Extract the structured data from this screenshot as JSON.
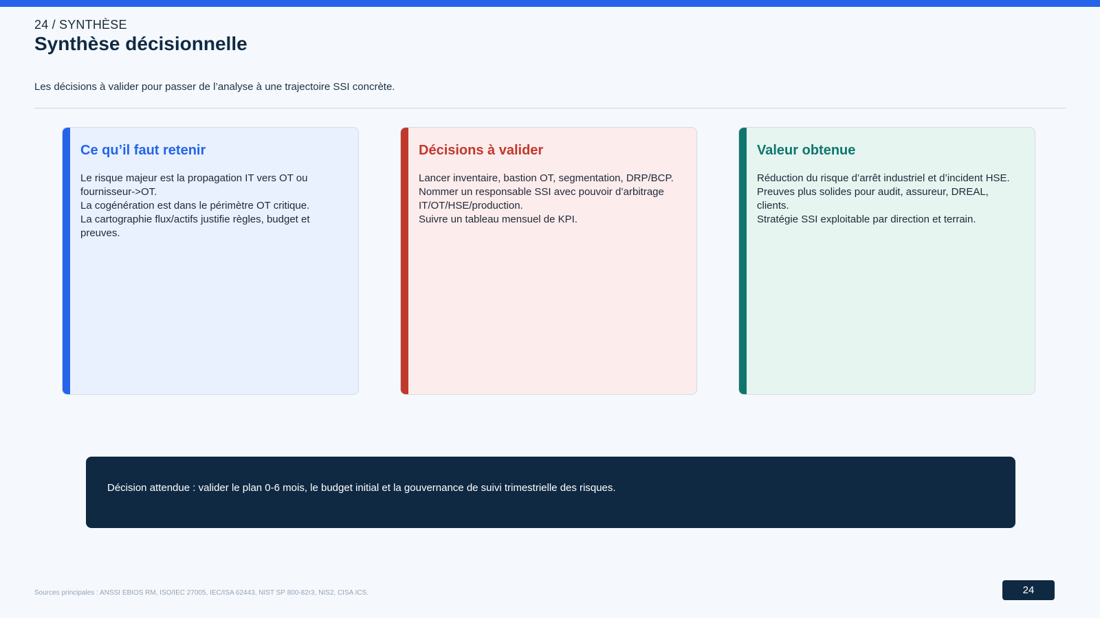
{
  "slide": {
    "kicker": "24 / SYNTHÈSE",
    "title": "Synthèse décisionnelle",
    "subtitle": "Les décisions à valider pour passer de l’analyse à une trajectoire SSI concrète.",
    "page_number": "24",
    "sources": "Sources principales : ANSSI EBIOS RM, ISO/IEC 27005, IEC/ISA 62443, NIST SP 800-82r3, NIS2, CISA ICS."
  },
  "cards": [
    {
      "title": "Ce qu’il faut retenir",
      "accent_color": "#2563eb",
      "lines": [
        "Le risque majeur est la propagation IT vers OT ou fournisseur->OT.",
        "La cogénération est dans le périmètre OT critique.",
        "La cartographie flux/actifs justifie règles, budget et preuves."
      ]
    },
    {
      "title": "Décisions à valider",
      "accent_color": "#c0392b",
      "lines": [
        "Lancer inventaire, bastion OT, segmentation, DRP/BCP.",
        "Nommer un responsable SSI avec pouvoir d’arbitrage IT/OT/HSE/production.",
        "Suivre un tableau mensuel de KPI."
      ]
    },
    {
      "title": "Valeur obtenue",
      "accent_color": "#0f766e",
      "lines": [
        "Réduction du risque d’arrêt industriel et d’incident HSE.",
        "Preuves plus solides pour audit, assureur, DREAL, clients.",
        "Stratégie SSI exploitable par direction et terrain."
      ]
    }
  ],
  "banner": {
    "text": "Décision attendue : valider le plan 0-6 mois, le budget initial et la gouvernance de suivi trimestrielle des risques."
  }
}
